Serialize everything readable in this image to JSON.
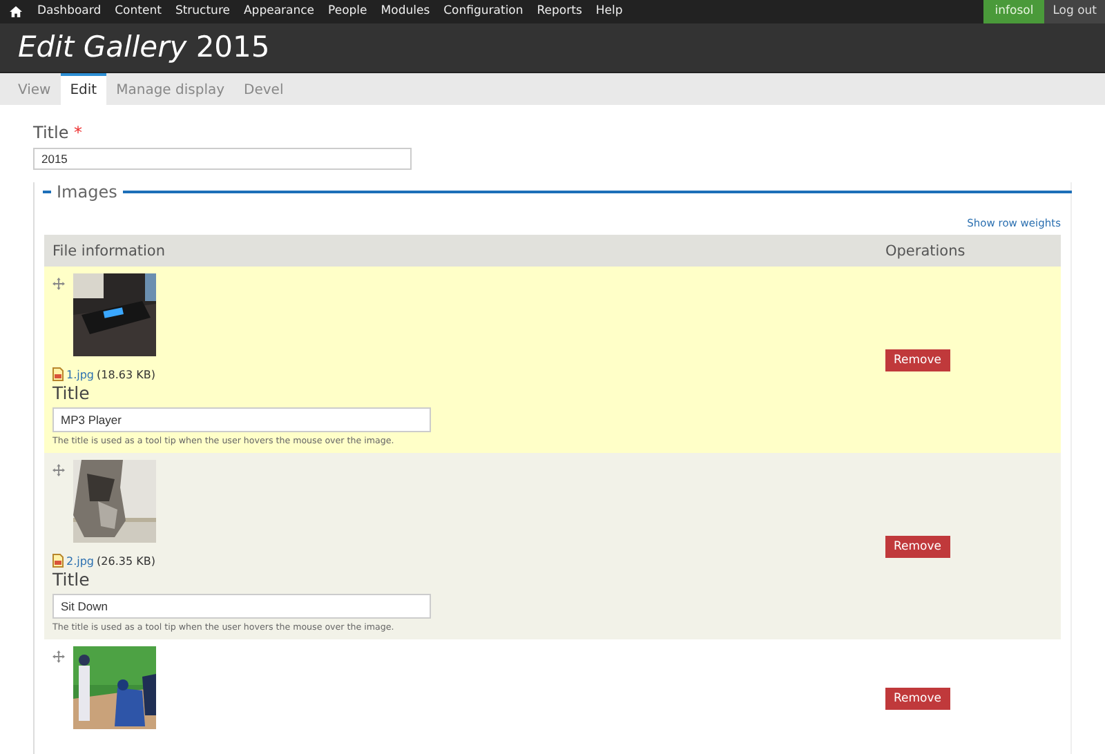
{
  "toolbar": {
    "menu": [
      "Dashboard",
      "Content",
      "Structure",
      "Appearance",
      "People",
      "Modules",
      "Configuration",
      "Reports",
      "Help"
    ],
    "user": "infosol",
    "logout": "Log out"
  },
  "page_title": "*Edit Gallery* 2015",
  "tabs": [
    {
      "label": "View",
      "selected": false
    },
    {
      "label": "Edit",
      "selected": true
    },
    {
      "label": "Manage display",
      "selected": false
    },
    {
      "label": "Devel",
      "selected": false
    }
  ],
  "title_field": {
    "label": "Title",
    "required_mark": "*",
    "value": "2015"
  },
  "images": {
    "legend": "Images",
    "row_weights_link": "Show row weights",
    "columns": [
      "File information",
      "Operations"
    ],
    "rows": [
      {
        "highlighted": true,
        "file_name": "1.jpg",
        "file_size": "(18.63 KB)",
        "title_label": "Title",
        "title_value": "MP3 Player",
        "description": "The title is used as a tool tip when the user hovers the mouse over the image.",
        "remove": "Remove"
      },
      {
        "highlighted": false,
        "file_name": "2.jpg",
        "file_size": "(26.35 KB)",
        "title_label": "Title",
        "title_value": "Sit Down",
        "description": "The title is used as a tool tip when the user hovers the mouse over the image.",
        "remove": "Remove"
      },
      {
        "highlighted": false,
        "remove": "Remove"
      }
    ]
  }
}
